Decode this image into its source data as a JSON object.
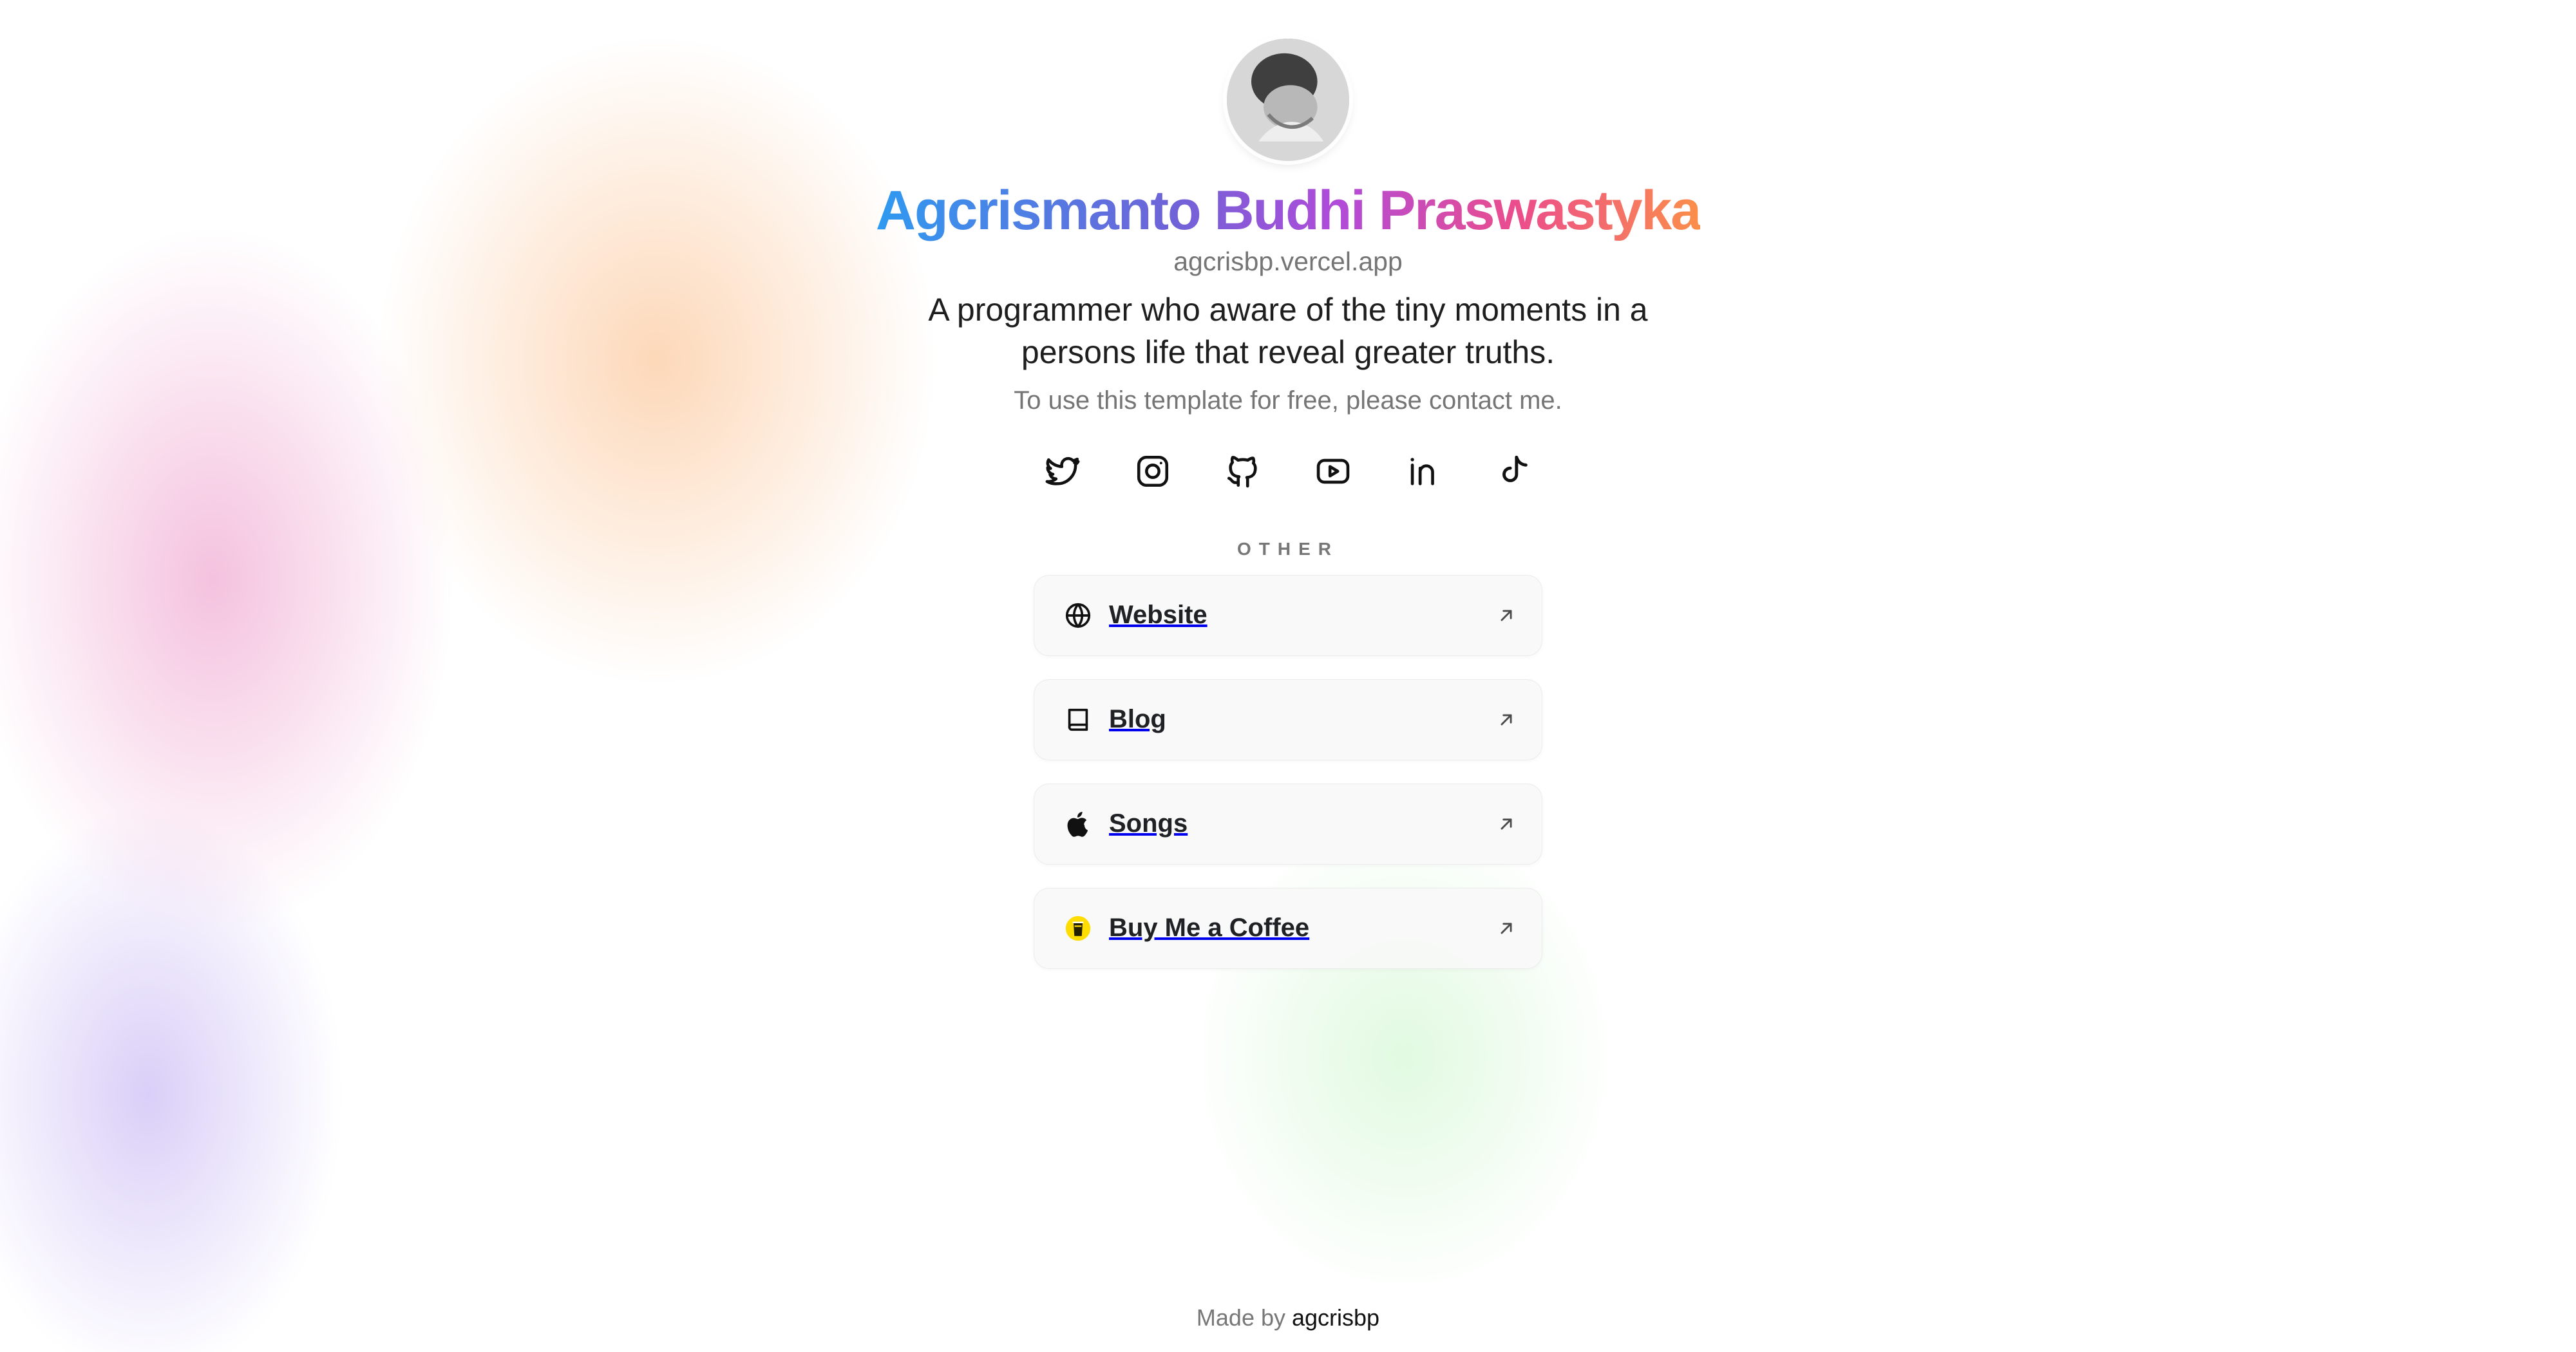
{
  "profile": {
    "avatar": "avatar",
    "name": "Agcrismanto Budhi Praswastyka",
    "url": "agcrisbp.vercel.app",
    "bio": "A programmer who aware of the tiny moments in a persons life that reveal greater truths.",
    "note": "To use this template for free, please contact me."
  },
  "social_links": [
    {
      "icon": "twitter-icon"
    },
    {
      "icon": "instagram-icon"
    },
    {
      "icon": "github-icon"
    },
    {
      "icon": "youtube-icon"
    },
    {
      "icon": "linkedin-icon"
    },
    {
      "icon": "tiktok-icon"
    }
  ],
  "other": {
    "heading": "OTHER",
    "links": [
      {
        "label": "Website",
        "icon": "globe-icon"
      },
      {
        "label": "Blog",
        "icon": "book-icon"
      },
      {
        "label": "Songs",
        "icon": "apple-icon"
      },
      {
        "label": "Buy Me a Coffee",
        "icon": "coffee-cup-icon"
      }
    ]
  },
  "footer": {
    "prefix": "Made by",
    "link": "agcrisbp"
  },
  "colors": {
    "name_gradient_start": "#2f9af0",
    "name_gradient_mid": "#b14bd9",
    "name_gradient_end": "#fb8f4a",
    "coffee_icon": "#ffdd00"
  }
}
